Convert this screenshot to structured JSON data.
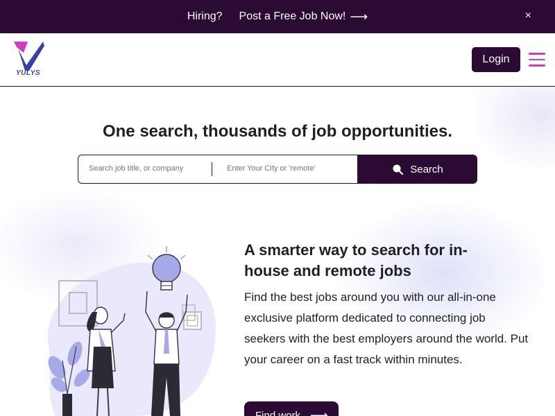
{
  "banner": {
    "hiring_text": "Hiring?",
    "post_link": "Post a Free Job Now!",
    "post_arrow": "⟶",
    "close_glyph": "×"
  },
  "header": {
    "logo_text": "YULYS",
    "login_label": "Login"
  },
  "hero": {
    "title": "One search, thousands of job opportunities."
  },
  "search": {
    "query_placeholder": "Search job title, or company",
    "location_placeholder": "Enter Your City or 'remote'",
    "button_label": "Search"
  },
  "feature": {
    "title": "A smarter way to search for in-house and remote jobs",
    "body": "Find the best jobs around you with our all-in-one exclusive platform dedicated to connecting job seekers with the best employers around the world. Put your career on a fast track within minutes.",
    "cta_label": "Find work",
    "cta_arrow": "⟶"
  },
  "colors": {
    "brand_dark": "#2b0a33",
    "brand_pink": "#d03bbf",
    "brand_blue": "#3b3fa3",
    "bulb": "#a7a8e8"
  },
  "icons": [
    "logo-icon",
    "close-icon",
    "menu-icon",
    "search-icon",
    "arrow-right-icon",
    "lightbulb-icon"
  ]
}
